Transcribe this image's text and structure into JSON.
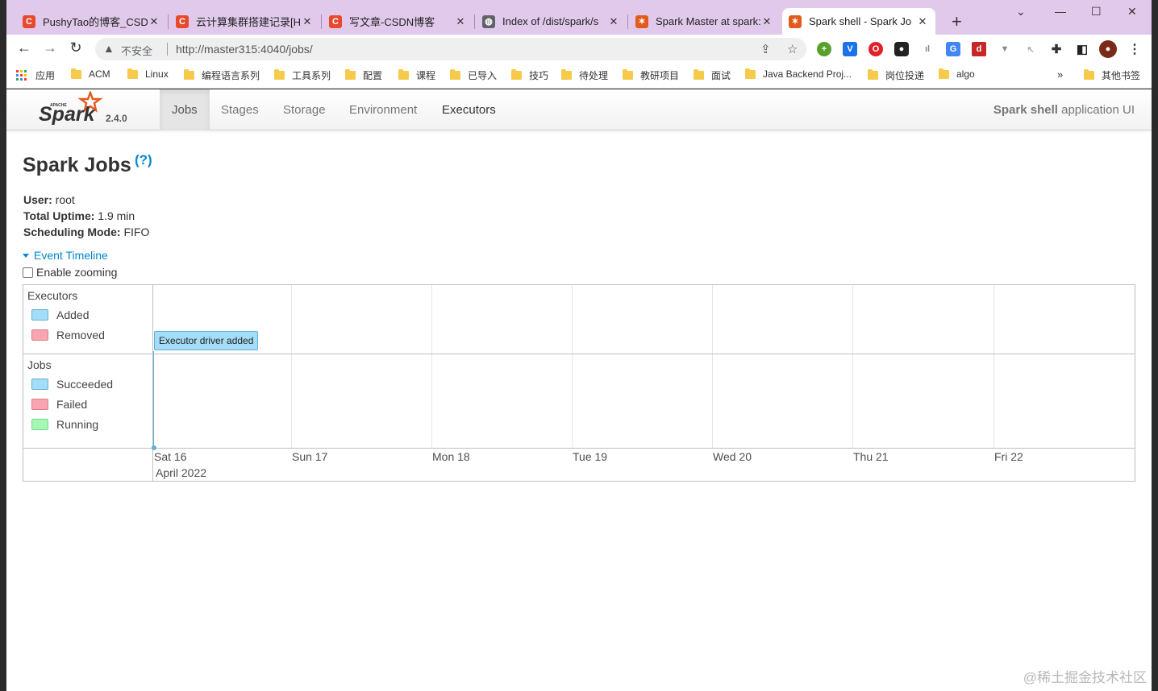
{
  "browser": {
    "tabs": [
      {
        "title": "PushyTao的博客_CSDN",
        "favicon": "csdn-icon",
        "color": "#e8492e",
        "letter": "C"
      },
      {
        "title": "云计算集群搭建记录[Ha",
        "favicon": "csdn-icon",
        "color": "#e8492e",
        "letter": "C"
      },
      {
        "title": "写文章-CSDN博客",
        "favicon": "csdn-icon",
        "color": "#e8492e",
        "letter": "C"
      },
      {
        "title": "Index of /dist/spark/s",
        "favicon": "globe-icon",
        "color": "#5f6368",
        "letter": "◍"
      },
      {
        "title": "Spark Master at spark:",
        "favicon": "spark-icon",
        "color": "#e25a1c",
        "letter": "✶"
      },
      {
        "title": "Spark shell - Spark Jo",
        "favicon": "spark-icon",
        "color": "#e25a1c",
        "letter": "✶"
      }
    ],
    "insecure_label": "不安全",
    "url": "http://master315:4040/jobs/",
    "bookmarks": [
      {
        "label": "应用",
        "type": "apps"
      },
      {
        "label": "ACM",
        "type": "folder"
      },
      {
        "label": "Linux",
        "type": "folder"
      },
      {
        "label": "编程语言系列",
        "type": "folder"
      },
      {
        "label": "工具系列",
        "type": "folder"
      },
      {
        "label": "配置",
        "type": "folder"
      },
      {
        "label": "课程",
        "type": "folder"
      },
      {
        "label": "已导入",
        "type": "folder"
      },
      {
        "label": "技巧",
        "type": "folder"
      },
      {
        "label": "待处理",
        "type": "folder"
      },
      {
        "label": "教研项目",
        "type": "folder"
      },
      {
        "label": "面试",
        "type": "folder"
      },
      {
        "label": "Java Backend Proj...",
        "type": "folder"
      },
      {
        "label": "岗位投递",
        "type": "folder"
      },
      {
        "label": "algo",
        "type": "folder"
      }
    ],
    "more_bookmarks": "»",
    "other_bookmarks": "其他书签"
  },
  "spark": {
    "version": "2.4.0",
    "nav": [
      "Jobs",
      "Stages",
      "Storage",
      "Environment",
      "Executors"
    ],
    "app_name_bold": "Spark shell",
    "app_name_rest": " application UI",
    "page_title": "Spark Jobs",
    "help": "(?)",
    "user_label": "User:",
    "user_value": " root",
    "uptime_label": "Total Uptime:",
    "uptime_value": " 1.9 min",
    "mode_label": "Scheduling Mode:",
    "mode_value": " FIFO",
    "timeline_link": "Event Timeline",
    "zoom_label": "Enable zooming"
  },
  "timeline": {
    "executors_title": "Executors",
    "executors_legend": [
      {
        "label": "Added",
        "color": "#a4ddf8",
        "border": "#5fb1d8"
      },
      {
        "label": "Removed",
        "color": "#f7a6b1",
        "border": "#e07b8a"
      }
    ],
    "jobs_title": "Jobs",
    "jobs_legend": [
      {
        "label": "Succeeded",
        "color": "#a4ddf8",
        "border": "#5fb1d8"
      },
      {
        "label": "Failed",
        "color": "#f7a6b1",
        "border": "#e07b8a"
      },
      {
        "label": "Running",
        "color": "#a6f7b5",
        "border": "#77d98a"
      }
    ],
    "axis_days": [
      "Sat 16",
      "Sun 17",
      "Mon 18",
      "Tue 19",
      "Wed 20",
      "Thu 21",
      "Fri 22"
    ],
    "axis_month": "April 2022",
    "event_label": "Executor driver added"
  },
  "watermark": "@稀土掘金技术社区"
}
